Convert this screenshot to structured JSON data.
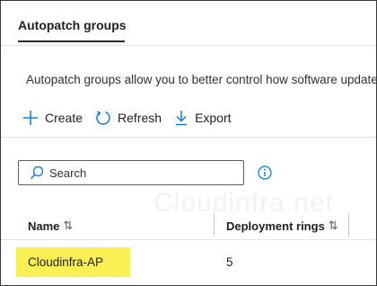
{
  "tab": {
    "label": "Autopatch groups"
  },
  "description": "Autopatch groups allow you to better control how software updates",
  "toolbar": {
    "create_label": "Create",
    "refresh_label": "Refresh",
    "export_label": "Export"
  },
  "search": {
    "placeholder": "Search",
    "value": ""
  },
  "watermark": "Cloudinfra.net",
  "table": {
    "columns": [
      {
        "label": "Name",
        "sort_icon": "sort-arrows-icon"
      },
      {
        "label": "Deployment rings",
        "sort_icon": "sort-arrows-icon"
      }
    ],
    "rows": [
      {
        "name": "Cloudinfra-AP",
        "deployment_rings": "5"
      }
    ]
  },
  "colors": {
    "accent": "#0078d4",
    "highlight": "#fbef56",
    "text": "#1f1f1f"
  }
}
